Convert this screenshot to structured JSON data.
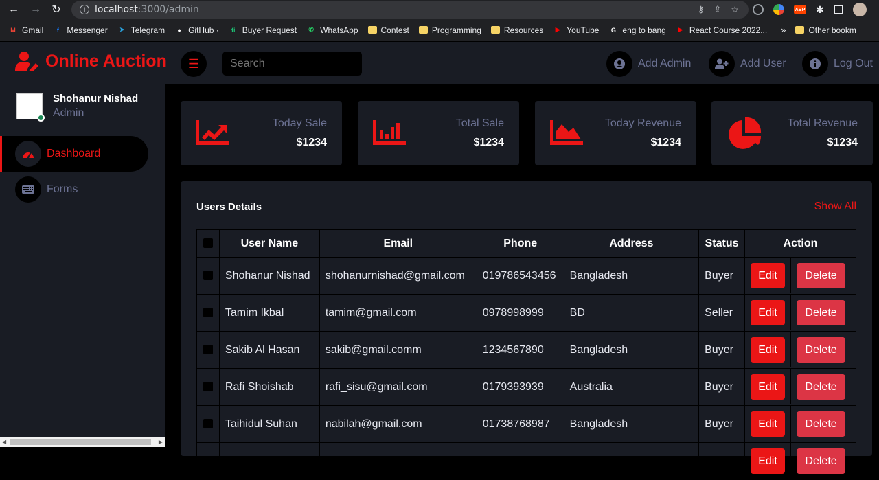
{
  "browser": {
    "url_host": "localhost",
    "url_path": ":3000/admin",
    "bookmarks": [
      {
        "label": "Gmail",
        "icon": "gmail-icon",
        "color": "#ea4335",
        "glyph": "M"
      },
      {
        "label": "Messenger",
        "icon": "facebook-icon",
        "color": "#1877f2",
        "glyph": "f"
      },
      {
        "label": "Telegram",
        "icon": "telegram-icon",
        "color": "#2aa3df",
        "glyph": "➤"
      },
      {
        "label": "GitHub ·",
        "icon": "github-icon",
        "color": "#ffffff",
        "glyph": "●"
      },
      {
        "label": "Buyer Request",
        "icon": "fiverr-icon",
        "color": "#1dbf73",
        "glyph": "fi"
      },
      {
        "label": "WhatsApp",
        "icon": "whatsapp-icon",
        "color": "#25d366",
        "glyph": "✆"
      },
      {
        "label": "Contest",
        "icon": "folder-icon",
        "color": "#f6d365",
        "glyph": ""
      },
      {
        "label": "Programming",
        "icon": "folder-icon",
        "color": "#f6d365",
        "glyph": ""
      },
      {
        "label": "Resources",
        "icon": "folder-icon",
        "color": "#f6d365",
        "glyph": ""
      },
      {
        "label": "YouTube",
        "icon": "youtube-icon",
        "color": "#ff0000",
        "glyph": "▶"
      },
      {
        "label": "eng to bang",
        "icon": "google-icon",
        "color": "#ffffff",
        "glyph": "G"
      },
      {
        "label": "React Course 2022...",
        "icon": "youtube-icon",
        "color": "#ff0000",
        "glyph": "▶"
      }
    ],
    "more": "»",
    "other_bookmarks": "Other bookm"
  },
  "app": {
    "brand": "Online Auction",
    "search_placeholder": "Search",
    "actions": {
      "add_admin": "Add Admin",
      "add_user": "Add User",
      "logout": "Log Out"
    },
    "profile": {
      "name": "Shohanur Nishad",
      "role": "Admin"
    },
    "nav": {
      "dashboard": "Dashboard",
      "forms": "Forms"
    },
    "colors": {
      "accent": "#eb1616",
      "panel": "#191c24",
      "muted": "#6c7293"
    }
  },
  "cards": [
    {
      "label": "Today Sale",
      "value": "$1234",
      "icon": "line-chart-icon"
    },
    {
      "label": "Total Sale",
      "value": "$1234",
      "icon": "bar-chart-icon"
    },
    {
      "label": "Today Revenue",
      "value": "$1234",
      "icon": "area-chart-icon"
    },
    {
      "label": "Total Revenue",
      "value": "$1234",
      "icon": "pie-chart-icon"
    }
  ],
  "users": {
    "title": "Users Details",
    "show_all": "Show All",
    "columns": {
      "name": "User Name",
      "email": "Email",
      "phone": "Phone",
      "address": "Address",
      "status": "Status",
      "action": "Action"
    },
    "edit_label": "Edit",
    "delete_label": "Delete",
    "rows": [
      {
        "name": "Shohanur Nishad",
        "email": "shohanurnishad@gmail.com",
        "phone": "019786543456",
        "address": "Bangladesh",
        "status": "Buyer"
      },
      {
        "name": "Tamim Ikbal",
        "email": "tamim@gmail.com",
        "phone": "0978998999",
        "address": "BD",
        "status": "Seller"
      },
      {
        "name": "Sakib Al Hasan",
        "email": "sakib@gmail.comm",
        "phone": "1234567890",
        "address": "Bangladesh",
        "status": "Buyer"
      },
      {
        "name": "Rafi Shoishab",
        "email": "rafi_sisu@gmail.com",
        "phone": "0179393939",
        "address": "Australia",
        "status": "Buyer"
      },
      {
        "name": "Taihidul Suhan",
        "email": "nabilah@gmail.com",
        "phone": "01738768987",
        "address": "Bangladesh",
        "status": "Buyer"
      },
      {
        "name": "",
        "email": "",
        "phone": "",
        "address": "",
        "status": ""
      }
    ]
  }
}
